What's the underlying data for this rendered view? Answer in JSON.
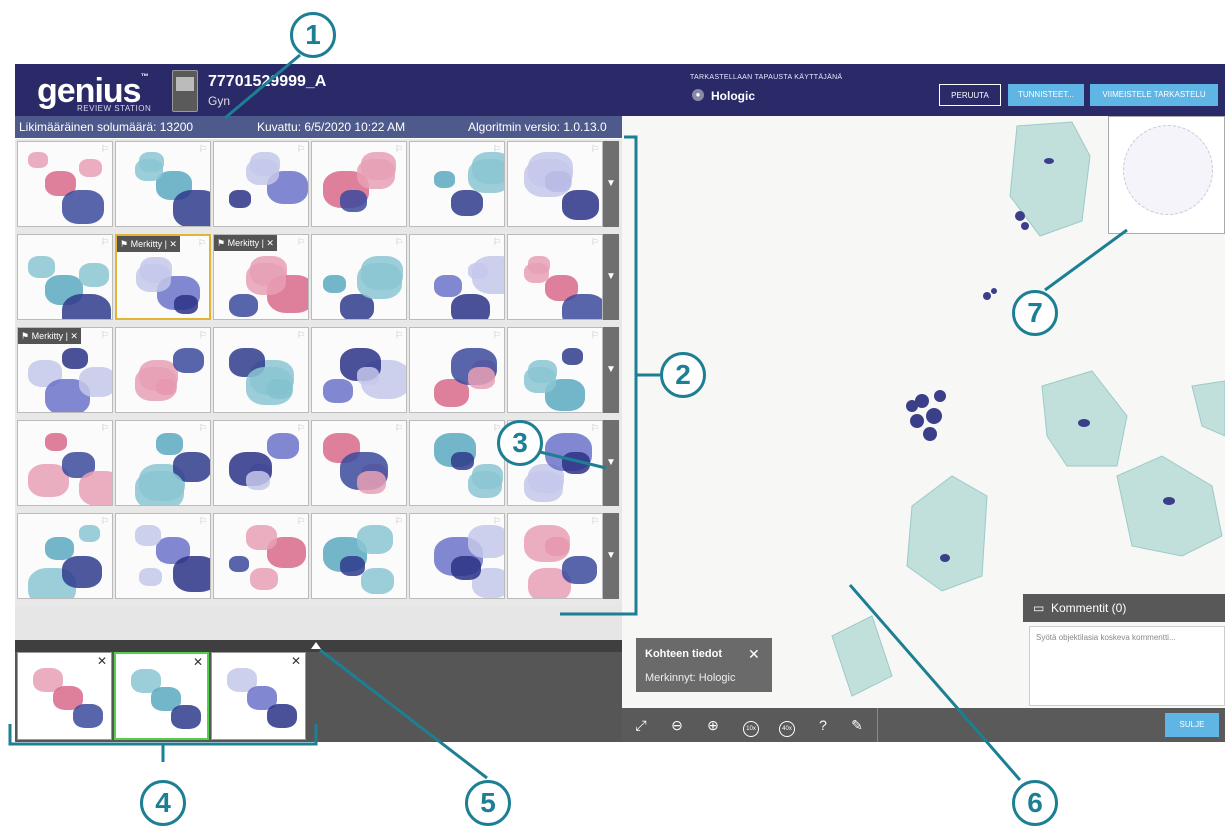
{
  "header": {
    "logo": "genius",
    "logo_tm": "™",
    "logo_sub": "REVIEW STATION",
    "case_id": "77701529999_A",
    "case_type": "Gyn",
    "reviewer_caption": "TARKASTELLAAN TAPAUSTA KÄYTTÄJÄNÄ",
    "reviewer_name": "Hologic",
    "buttons": {
      "cancel": "PERUUTA",
      "identifiers": "TUNNISTEET...",
      "finish": "VIIMEISTELE TARKASTELU"
    }
  },
  "info_bar": {
    "cell_count": "Likimääräinen solumäärä: 13200",
    "scanned": "Kuvattu: 6/5/2020 10:22 AM",
    "algorithm": "Algoritmin versio: 1.0.13.0"
  },
  "gallery": {
    "tag_label": "Merkitty",
    "rows": [
      {
        "tiles": [
          {
            "tag": false
          },
          {
            "tag": false
          },
          {
            "tag": false
          },
          {
            "tag": false
          },
          {
            "tag": false
          },
          {
            "tag": false
          }
        ]
      },
      {
        "tiles": [
          {
            "tag": false
          },
          {
            "tag": true,
            "selected": true
          },
          {
            "tag": true
          },
          {
            "tag": false
          },
          {
            "tag": false
          },
          {
            "tag": false
          }
        ]
      },
      {
        "tiles": [
          {
            "tag": true
          },
          {
            "tag": false
          },
          {
            "tag": false
          },
          {
            "tag": false
          },
          {
            "tag": false
          },
          {
            "tag": false
          }
        ]
      },
      {
        "tiles": [
          {
            "tag": false
          },
          {
            "tag": false
          },
          {
            "tag": false
          },
          {
            "tag": false
          },
          {
            "tag": false
          },
          {
            "tag": false
          }
        ]
      },
      {
        "tiles": [
          {
            "tag": false
          },
          {
            "tag": false
          },
          {
            "tag": false
          },
          {
            "tag": false
          },
          {
            "tag": false
          },
          {
            "tag": false
          }
        ]
      }
    ]
  },
  "tray": {
    "item_count": 3,
    "active_index": 1
  },
  "object_info": {
    "title": "Kohteen tiedot",
    "marked_by": "Merkinnyt: Hologic"
  },
  "comments": {
    "title": "Kommentit (0)",
    "placeholder": "Syötä objektilasia koskeva kommentti..."
  },
  "toolbar": {
    "tools": [
      "fullscreen-icon",
      "zoom-out-icon",
      "zoom-in-icon",
      "zoom-10x-icon",
      "zoom-40x-icon",
      "help-icon",
      "annotate-pen-icon"
    ],
    "zoom10": "10x",
    "zoom40": "40x",
    "help": "?",
    "close": "SULJE"
  },
  "callouts": [
    "1",
    "2",
    "3",
    "4",
    "5",
    "6",
    "7"
  ],
  "colors": {
    "header": "#2b2a68",
    "infobar": "#4f5a8c",
    "accent": "#5fb5e3",
    "callout": "#1d7f93",
    "selected_tile": "#e2b534",
    "active_tray": "#52d04a"
  }
}
